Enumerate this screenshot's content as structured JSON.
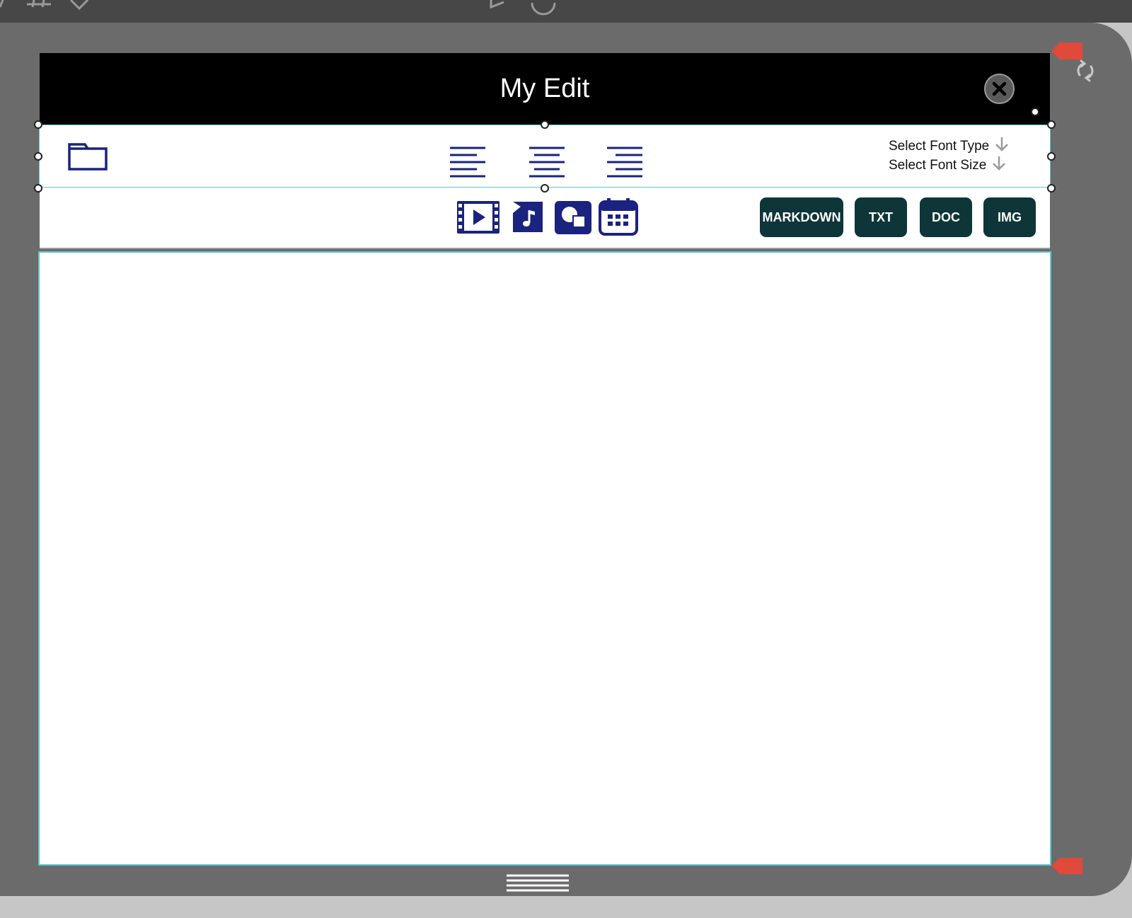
{
  "window": {
    "title": "My Edit"
  },
  "toolbar": {
    "font_type_label": "Select Font Type",
    "font_size_label": "Select Font Size",
    "export_buttons": [
      "MARKDOWN",
      "TXT",
      "DOC",
      "IMG"
    ]
  },
  "icons": {
    "open": "folder-icon",
    "align": [
      "align-left-icon",
      "align-center-icon",
      "align-right-icon"
    ],
    "insert": [
      "video-icon",
      "music-icon",
      "shapes-icon",
      "calendar-icon"
    ],
    "close": "close-icon",
    "rotate": "rotate-icon",
    "dropdown": "arrow-down-icon",
    "resize": "resize-grip-icon"
  },
  "colors": {
    "titlebar": "#000000",
    "icon_blue": "#1a237e",
    "button_fill": "#0e3538",
    "selection_border": "#5ec9d2",
    "device_frame": "#6b6b6b",
    "marker_red": "#e04a3a"
  }
}
